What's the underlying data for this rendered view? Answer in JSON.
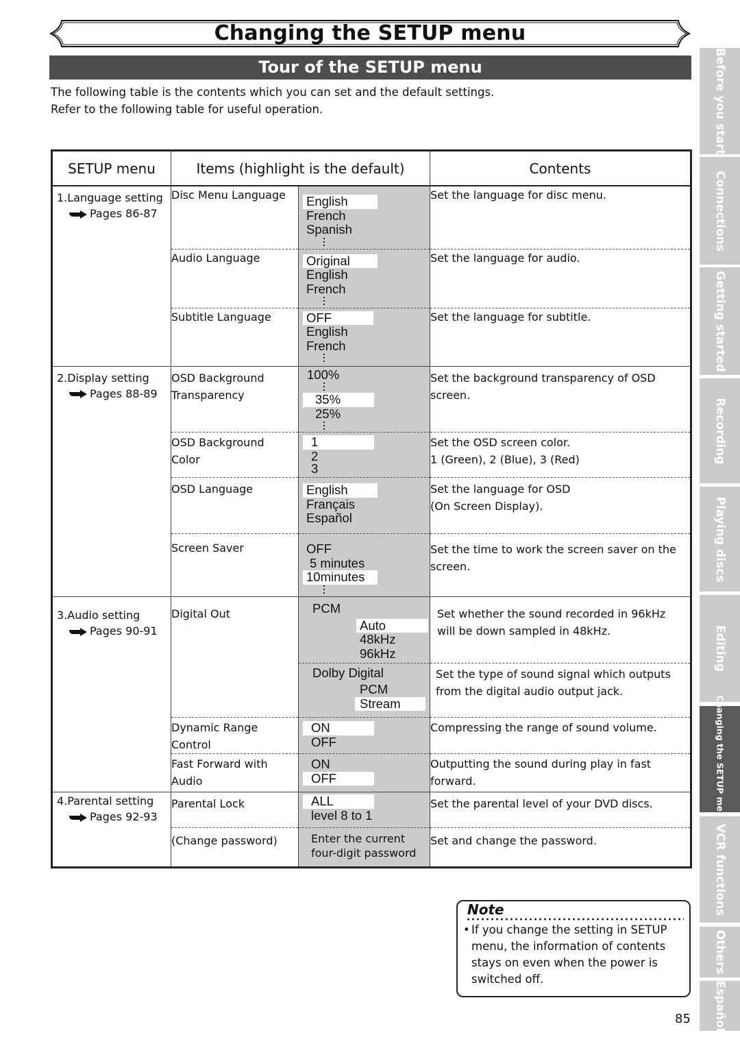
{
  "header": {
    "title": "Changing the SETUP menu",
    "section": "Tour of the SETUP menu"
  },
  "intro": {
    "line1": "The following table is the contents which you can set and the default settings.",
    "line2": "Refer to the following table for useful operation."
  },
  "table": {
    "headers": {
      "setup_menu": "SETUP menu",
      "items": "Items (highlight is the default)",
      "contents": "Contents"
    },
    "groups": [
      {
        "name": "1.Language setting",
        "pages": "Pages 86-87"
      },
      {
        "name": "2.Display setting",
        "pages": "Pages 88-89"
      },
      {
        "name": "3.Audio setting",
        "pages": "Pages 90-91"
      },
      {
        "name": "4.Parental setting",
        "pages": "Pages 92-93"
      }
    ],
    "rows": {
      "disc_menu_language": {
        "item": "Disc Menu Language",
        "options": [
          "English",
          "French",
          "Spanish"
        ],
        "default": "English",
        "more": true,
        "description": "Set the language for disc menu."
      },
      "audio_language": {
        "item": "Audio Language",
        "options": [
          "Original",
          "English",
          "French"
        ],
        "default": "Original",
        "more": true,
        "description": "Set the language for audio."
      },
      "subtitle_language": {
        "item": "Subtitle Language",
        "options": [
          "OFF",
          "English",
          "French"
        ],
        "default": "OFF",
        "more": true,
        "description": "Set the language for subtitle."
      },
      "osd_transparency": {
        "item_line1": "OSD Background",
        "item_line2": "Transparency",
        "options": [
          "100%",
          "35%",
          "25%"
        ],
        "default": "35%",
        "description": "Set the background transparency of OSD screen."
      },
      "osd_color": {
        "item_line1": "OSD Background",
        "item_line2": "Color",
        "options": [
          "1",
          "2",
          "3"
        ],
        "default": "1",
        "description_line1": "Set the OSD screen color.",
        "description_line2": "1 (Green), 2 (Blue), 3 (Red)"
      },
      "osd_language": {
        "item": "OSD Language",
        "options": [
          "English",
          "Français",
          "Español"
        ],
        "default": "English",
        "description_line1": "Set the language for OSD",
        "description_line2": "(On Screen Display)."
      },
      "screen_saver": {
        "item": "Screen Saver",
        "options": [
          "OFF",
          "5 minutes",
          "10minutes"
        ],
        "default": "10minutes",
        "more": true,
        "description": "Set the time to work the screen saver on the screen."
      },
      "digital_out": {
        "item": "Digital Out",
        "pcm": {
          "label": "PCM",
          "options": [
            "Auto",
            "48kHz",
            "96kHz"
          ],
          "default": "Auto",
          "description": "Set whether the sound recorded in 96kHz will be down sampled in 48kHz."
        },
        "dolby": {
          "label": "Dolby Digital",
          "options": [
            "PCM",
            "Stream"
          ],
          "default": "Stream",
          "description": "Set the type of sound signal which outputs from the digital audio output jack."
        }
      },
      "dynamic_range": {
        "item_line1": "Dynamic Range",
        "item_line2": "Control",
        "options": [
          "ON",
          "OFF"
        ],
        "default": "ON",
        "description": "Compressing the range of sound volume."
      },
      "ff_audio": {
        "item_line1": "Fast Forward with",
        "item_line2": "Audio",
        "options": [
          "ON",
          "OFF"
        ],
        "default": "OFF",
        "description": "Outputting the sound during play in fast forward."
      },
      "parental_lock": {
        "item": "Parental Lock",
        "options": [
          "ALL",
          "level 8 to 1"
        ],
        "default": "ALL",
        "description": "Set the parental level of your DVD discs."
      },
      "change_password": {
        "item": "(Change password)",
        "option_line1": "Enter the current",
        "option_line2": "four-digit password",
        "description": "Set and change the password."
      }
    }
  },
  "side_tabs": [
    {
      "label": "Before you start",
      "active": false
    },
    {
      "label": "Connections",
      "active": false
    },
    {
      "label": "Getting started",
      "active": false
    },
    {
      "label": "Recording",
      "active": false
    },
    {
      "label": "Playing discs",
      "active": false
    },
    {
      "label": "Editing",
      "active": false
    },
    {
      "label": "Changing the SETUP menu",
      "active": true
    },
    {
      "label": "VCR functions",
      "active": false
    },
    {
      "label": "Others",
      "active": false
    },
    {
      "label": "Español",
      "active": false
    }
  ],
  "note": {
    "title": "Note",
    "bullet": "•",
    "text": "If you change the setting in SETUP menu, the information of contents stays on even when the power is switched off."
  },
  "page_number": "85",
  "colors": {
    "section_bar": "#4d4d4d",
    "option_column": "#cbcbcb",
    "tab_inactive": "#cbcbcb",
    "tab_active": "#5a5a5a"
  }
}
